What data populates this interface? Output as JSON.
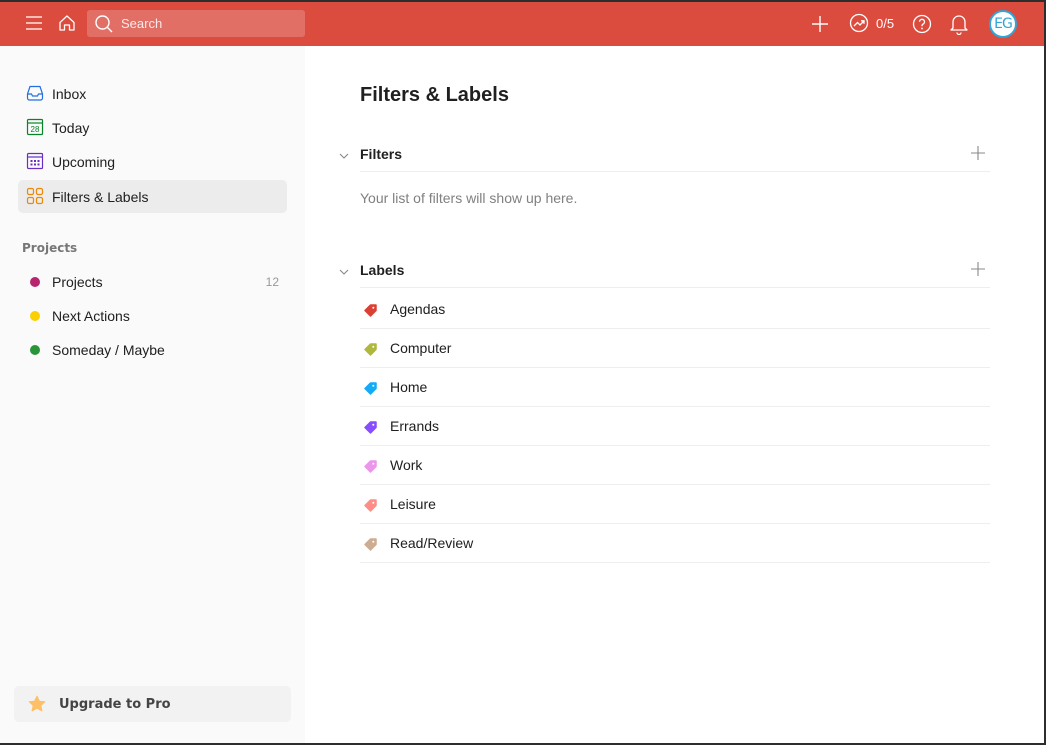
{
  "topbar": {
    "search_placeholder": "Search",
    "karma_value": "0/5",
    "avatar_initials": "EG",
    "brand_color": "#db4c3f"
  },
  "sidebar": {
    "nav": [
      {
        "label": "Inbox",
        "icon": "inbox-icon",
        "color": "#246fe0"
      },
      {
        "label": "Today",
        "icon": "calendar-today-icon",
        "day": "28",
        "color": "#058527"
      },
      {
        "label": "Upcoming",
        "icon": "calendar-upcoming-icon",
        "color": "#692fc2"
      },
      {
        "label": "Filters & Labels",
        "icon": "filters-labels-icon",
        "color": "#eb8909",
        "active": true
      }
    ],
    "projects_heading": "Projects",
    "projects": [
      {
        "label": "Projects",
        "count": "12",
        "color": "#b8256f"
      },
      {
        "label": "Next Actions",
        "count": "",
        "color": "#fad000"
      },
      {
        "label": "Someday / Maybe",
        "count": "",
        "color": "#299438"
      }
    ],
    "upgrade_label": "Upgrade to Pro"
  },
  "main": {
    "title": "Filters & Labels",
    "filters": {
      "title": "Filters",
      "empty_text": "Your list of filters will show up here."
    },
    "labels": {
      "title": "Labels",
      "items": [
        {
          "label": "Agendas",
          "color": "#db4035"
        },
        {
          "label": "Computer",
          "color": "#afb83b"
        },
        {
          "label": "Home",
          "color": "#14aaf5"
        },
        {
          "label": "Errands",
          "color": "#884dff"
        },
        {
          "label": "Work",
          "color": "#eb96eb"
        },
        {
          "label": "Leisure",
          "color": "#ff8d85"
        },
        {
          "label": "Read/Review",
          "color": "#ccac93"
        }
      ]
    }
  }
}
